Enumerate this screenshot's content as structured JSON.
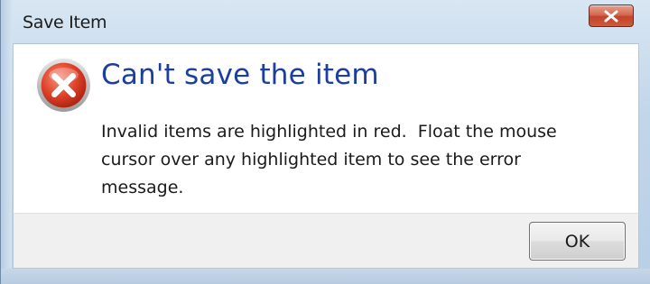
{
  "window": {
    "title": "Save Item"
  },
  "dialog": {
    "heading": "Can't save the item",
    "message": "Invalid items are highlighted in red.  Float the mouse\ncursor over any highlighted item to see the error\nmessage.",
    "icon": "error-icon",
    "ok_label": "OK"
  },
  "colors": {
    "heading": "#1c3f9e",
    "close_button": "#c94a30",
    "error_icon": "#d93a24"
  }
}
